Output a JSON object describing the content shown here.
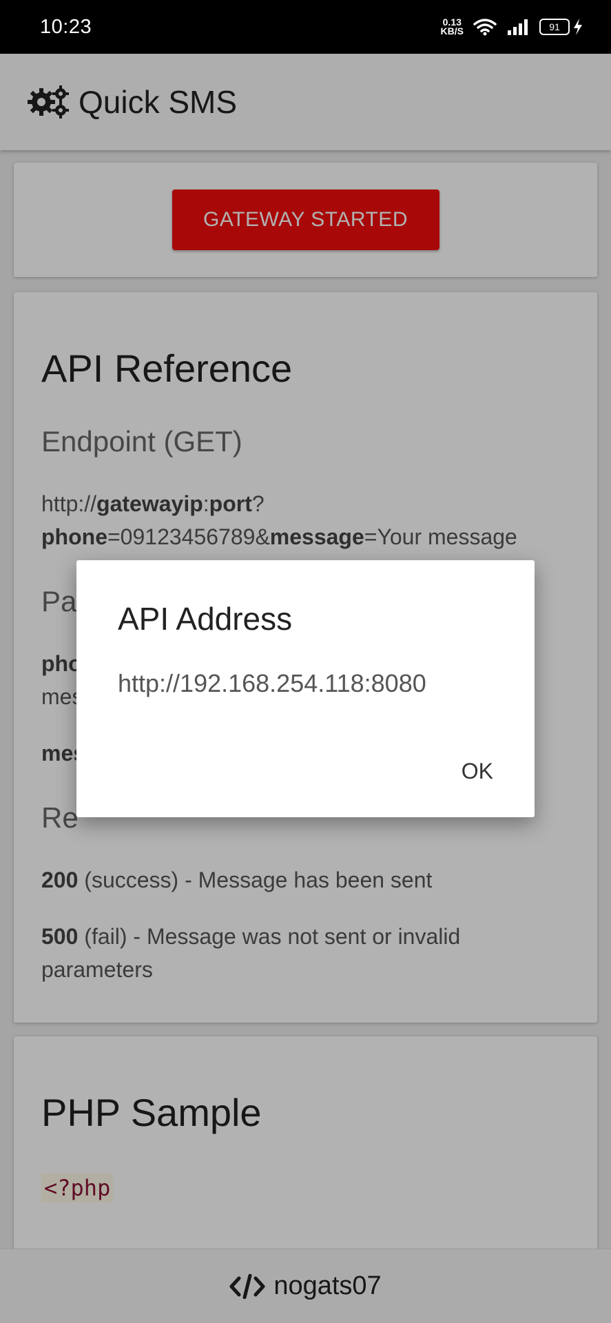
{
  "status_bar": {
    "time": "10:23",
    "net_speed_value": "0.13",
    "net_speed_unit": "KB/S",
    "battery_level": "91",
    "icons": [
      "wifi-icon",
      "signal-icon",
      "battery-icon",
      "charging-icon"
    ]
  },
  "app_bar": {
    "icon": "gears-icon",
    "title": "Quick SMS"
  },
  "gateway": {
    "button_label": "GATEWAY STARTED",
    "button_color": "#f10c0c"
  },
  "api_reference": {
    "title": "API Reference",
    "endpoint_heading": "Endpoint (GET)",
    "endpoint": {
      "prefix": "http://",
      "host": "gatewayip",
      "colon": ":",
      "port": "port",
      "q": "?",
      "phone_key": "phone",
      "phone_val": "=09123456789&",
      "message_key": "message",
      "message_val": "=Your message"
    },
    "params_heading_partial": "Pa",
    "param1_partial_bold": "pho",
    "param1_partial_line2": "mes",
    "param2_partial_bold": "mes",
    "responses_heading_partial": "Re",
    "responses": [
      {
        "code": "200",
        "text": " (success) - Message has been sent"
      },
      {
        "code": "500",
        "text": " (fail) - Message was not sent or invalid parameters"
      }
    ]
  },
  "php_sample": {
    "title": "PHP Sample",
    "code": "<?php"
  },
  "footer": {
    "icon": "code-icon",
    "author": "nogats07"
  },
  "dialog": {
    "title": "API Address",
    "address": "http://192.168.254.118:8080",
    "ok_label": "OK"
  }
}
